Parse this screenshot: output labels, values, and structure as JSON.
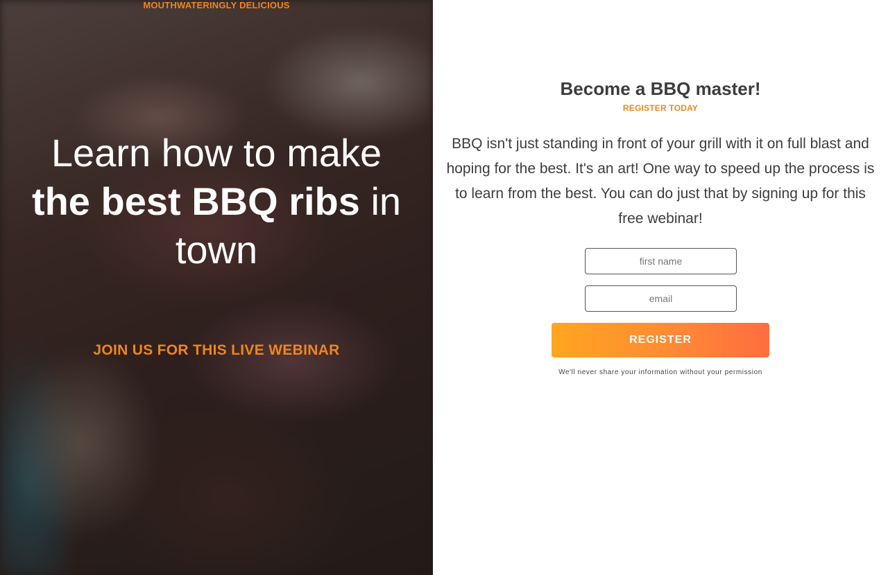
{
  "hero": {
    "eyebrow": "MOUTHWATERINGLY DELICIOUS",
    "title_part1": "Learn how to make ",
    "title_bold": "the best BBQ ribs",
    "title_part2": " in town",
    "cta": "JOIN US FOR THIS LIVE WEBINAR",
    "image": "bbq-ribs-photo"
  },
  "form": {
    "heading": "Become a BBQ master!",
    "subheading": "REGISTER TODAY",
    "body": "BBQ isn't just standing in front of your grill with it on full blast and hoping for the best. It's an art! One way to speed up the process is to learn from the best. You can do just that by signing up for this free webinar!",
    "first_name_placeholder": "first name",
    "email_placeholder": "email",
    "submit_label": "REGISTER",
    "privacy_note": "We'll never share your information without your permission"
  },
  "colors": {
    "accent": "#f0851d",
    "button_gradient_start": "#ffa620",
    "button_gradient_end": "#ff6d3f",
    "text": "#3d3d3d"
  }
}
